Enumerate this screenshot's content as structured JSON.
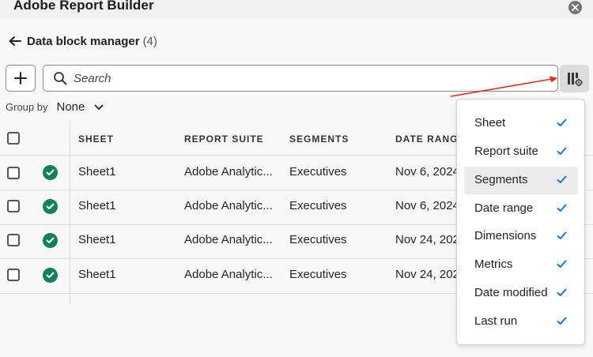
{
  "app": {
    "title": "Adobe Report Builder"
  },
  "header": {
    "title": "Data block manager",
    "count": "(4)"
  },
  "search": {
    "placeholder": "Search"
  },
  "groupby": {
    "label": "Group by",
    "value": "None"
  },
  "table": {
    "columns": [
      "SHEET",
      "REPORT SUITE",
      "SEGMENTS",
      "DATE RANGE"
    ],
    "rows": [
      {
        "sheet": "Sheet1",
        "suite": "Adobe Analytic...",
        "segments": "Executives",
        "date": "Nov 6, 2024",
        "status": "success"
      },
      {
        "sheet": "Sheet1",
        "suite": "Adobe Analytic...",
        "segments": "Executives",
        "date": "Nov 6, 2024",
        "status": "success"
      },
      {
        "sheet": "Sheet1",
        "suite": "Adobe Analytic...",
        "segments": "Executives",
        "date": "Nov 24, 2024",
        "status": "success"
      },
      {
        "sheet": "Sheet1",
        "suite": "Adobe Analytic...",
        "segments": "Executives",
        "date": "Nov 24, 2024",
        "status": "success"
      }
    ]
  },
  "column_menu": {
    "items": [
      {
        "label": "Sheet",
        "checked": true
      },
      {
        "label": "Report suite",
        "checked": true
      },
      {
        "label": "Segments",
        "checked": true
      },
      {
        "label": "Date range",
        "checked": true
      },
      {
        "label": "Dimensions",
        "checked": true
      },
      {
        "label": "Metrics",
        "checked": true
      },
      {
        "label": "Date modified",
        "checked": true
      },
      {
        "label": "Last run",
        "checked": true
      }
    ]
  },
  "colors": {
    "success": "#12805c",
    "check": "#1473e6",
    "annotation_arrow": "#e8291c"
  }
}
